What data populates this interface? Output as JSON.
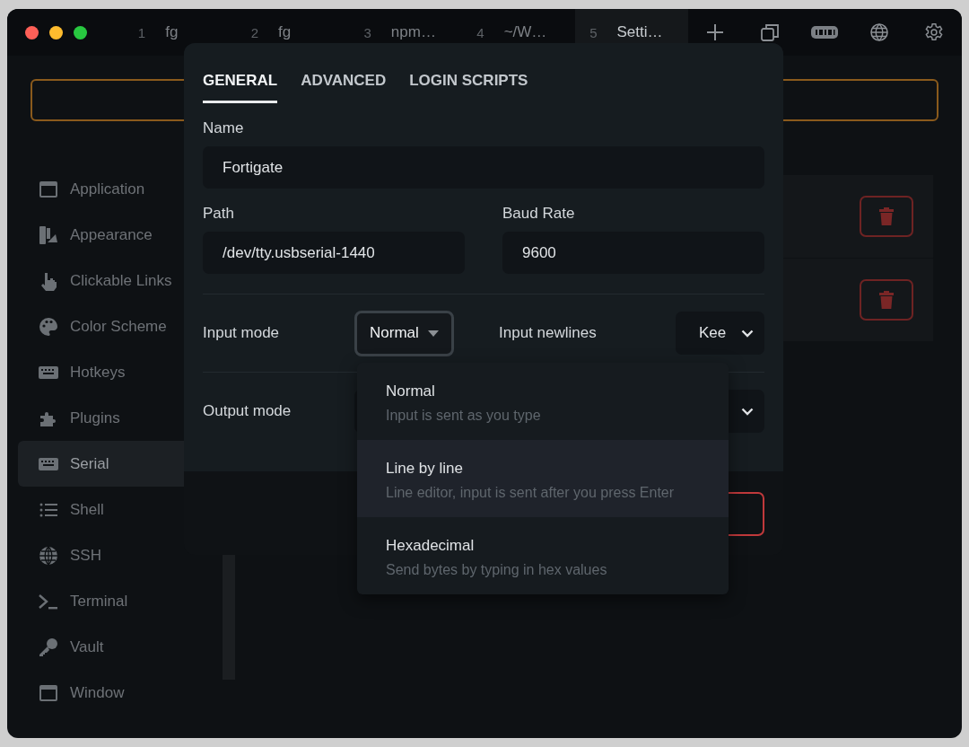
{
  "window": {
    "tabs": [
      {
        "number": "1",
        "title": "fg",
        "selected": false
      },
      {
        "number": "2",
        "title": "fg",
        "selected": false
      },
      {
        "number": "3",
        "title": "npm…",
        "selected": false
      },
      {
        "number": "4",
        "title": "~/W…",
        "selected": false
      },
      {
        "number": "5",
        "title": "Setti…",
        "selected": true
      }
    ]
  },
  "sidebar": {
    "items": [
      {
        "label": "Application",
        "selected": false
      },
      {
        "label": "Appearance",
        "selected": false
      },
      {
        "label": "Clickable Links",
        "selected": false
      },
      {
        "label": "Color Scheme",
        "selected": false
      },
      {
        "label": "Hotkeys",
        "selected": false
      },
      {
        "label": "Plugins",
        "selected": false
      },
      {
        "label": "Serial",
        "selected": true
      },
      {
        "label": "Shell",
        "selected": false
      },
      {
        "label": "SSH",
        "selected": false
      },
      {
        "label": "Terminal",
        "selected": false
      },
      {
        "label": "Vault",
        "selected": false
      },
      {
        "label": "Window",
        "selected": false
      }
    ]
  },
  "dialog": {
    "tabs": [
      {
        "label": "GENERAL",
        "selected": true
      },
      {
        "label": "ADVANCED",
        "selected": false
      },
      {
        "label": "LOGIN SCRIPTS",
        "selected": false
      }
    ],
    "name": {
      "label": "Name",
      "value": "Fortigate"
    },
    "path": {
      "label": "Path",
      "value": "/dev/tty.usbserial-1440"
    },
    "baud_rate": {
      "label": "Baud Rate",
      "value": "9600"
    },
    "input_mode": {
      "label": "Input mode",
      "value": "Normal",
      "expanded": true
    },
    "input_newlines": {
      "label": "Input newlines",
      "value": "Kee"
    },
    "output_mode": {
      "label": "Output mode"
    },
    "dropdown": {
      "options": [
        {
          "title": "Normal",
          "description": "Input is sent as you type",
          "highlighted": false
        },
        {
          "title": "Line by line",
          "description": "Line editor, input is sent after you press Enter",
          "highlighted": true
        },
        {
          "title": "Hexadecimal",
          "description": "Send bytes by typing in hex values",
          "highlighted": false
        }
      ]
    }
  }
}
